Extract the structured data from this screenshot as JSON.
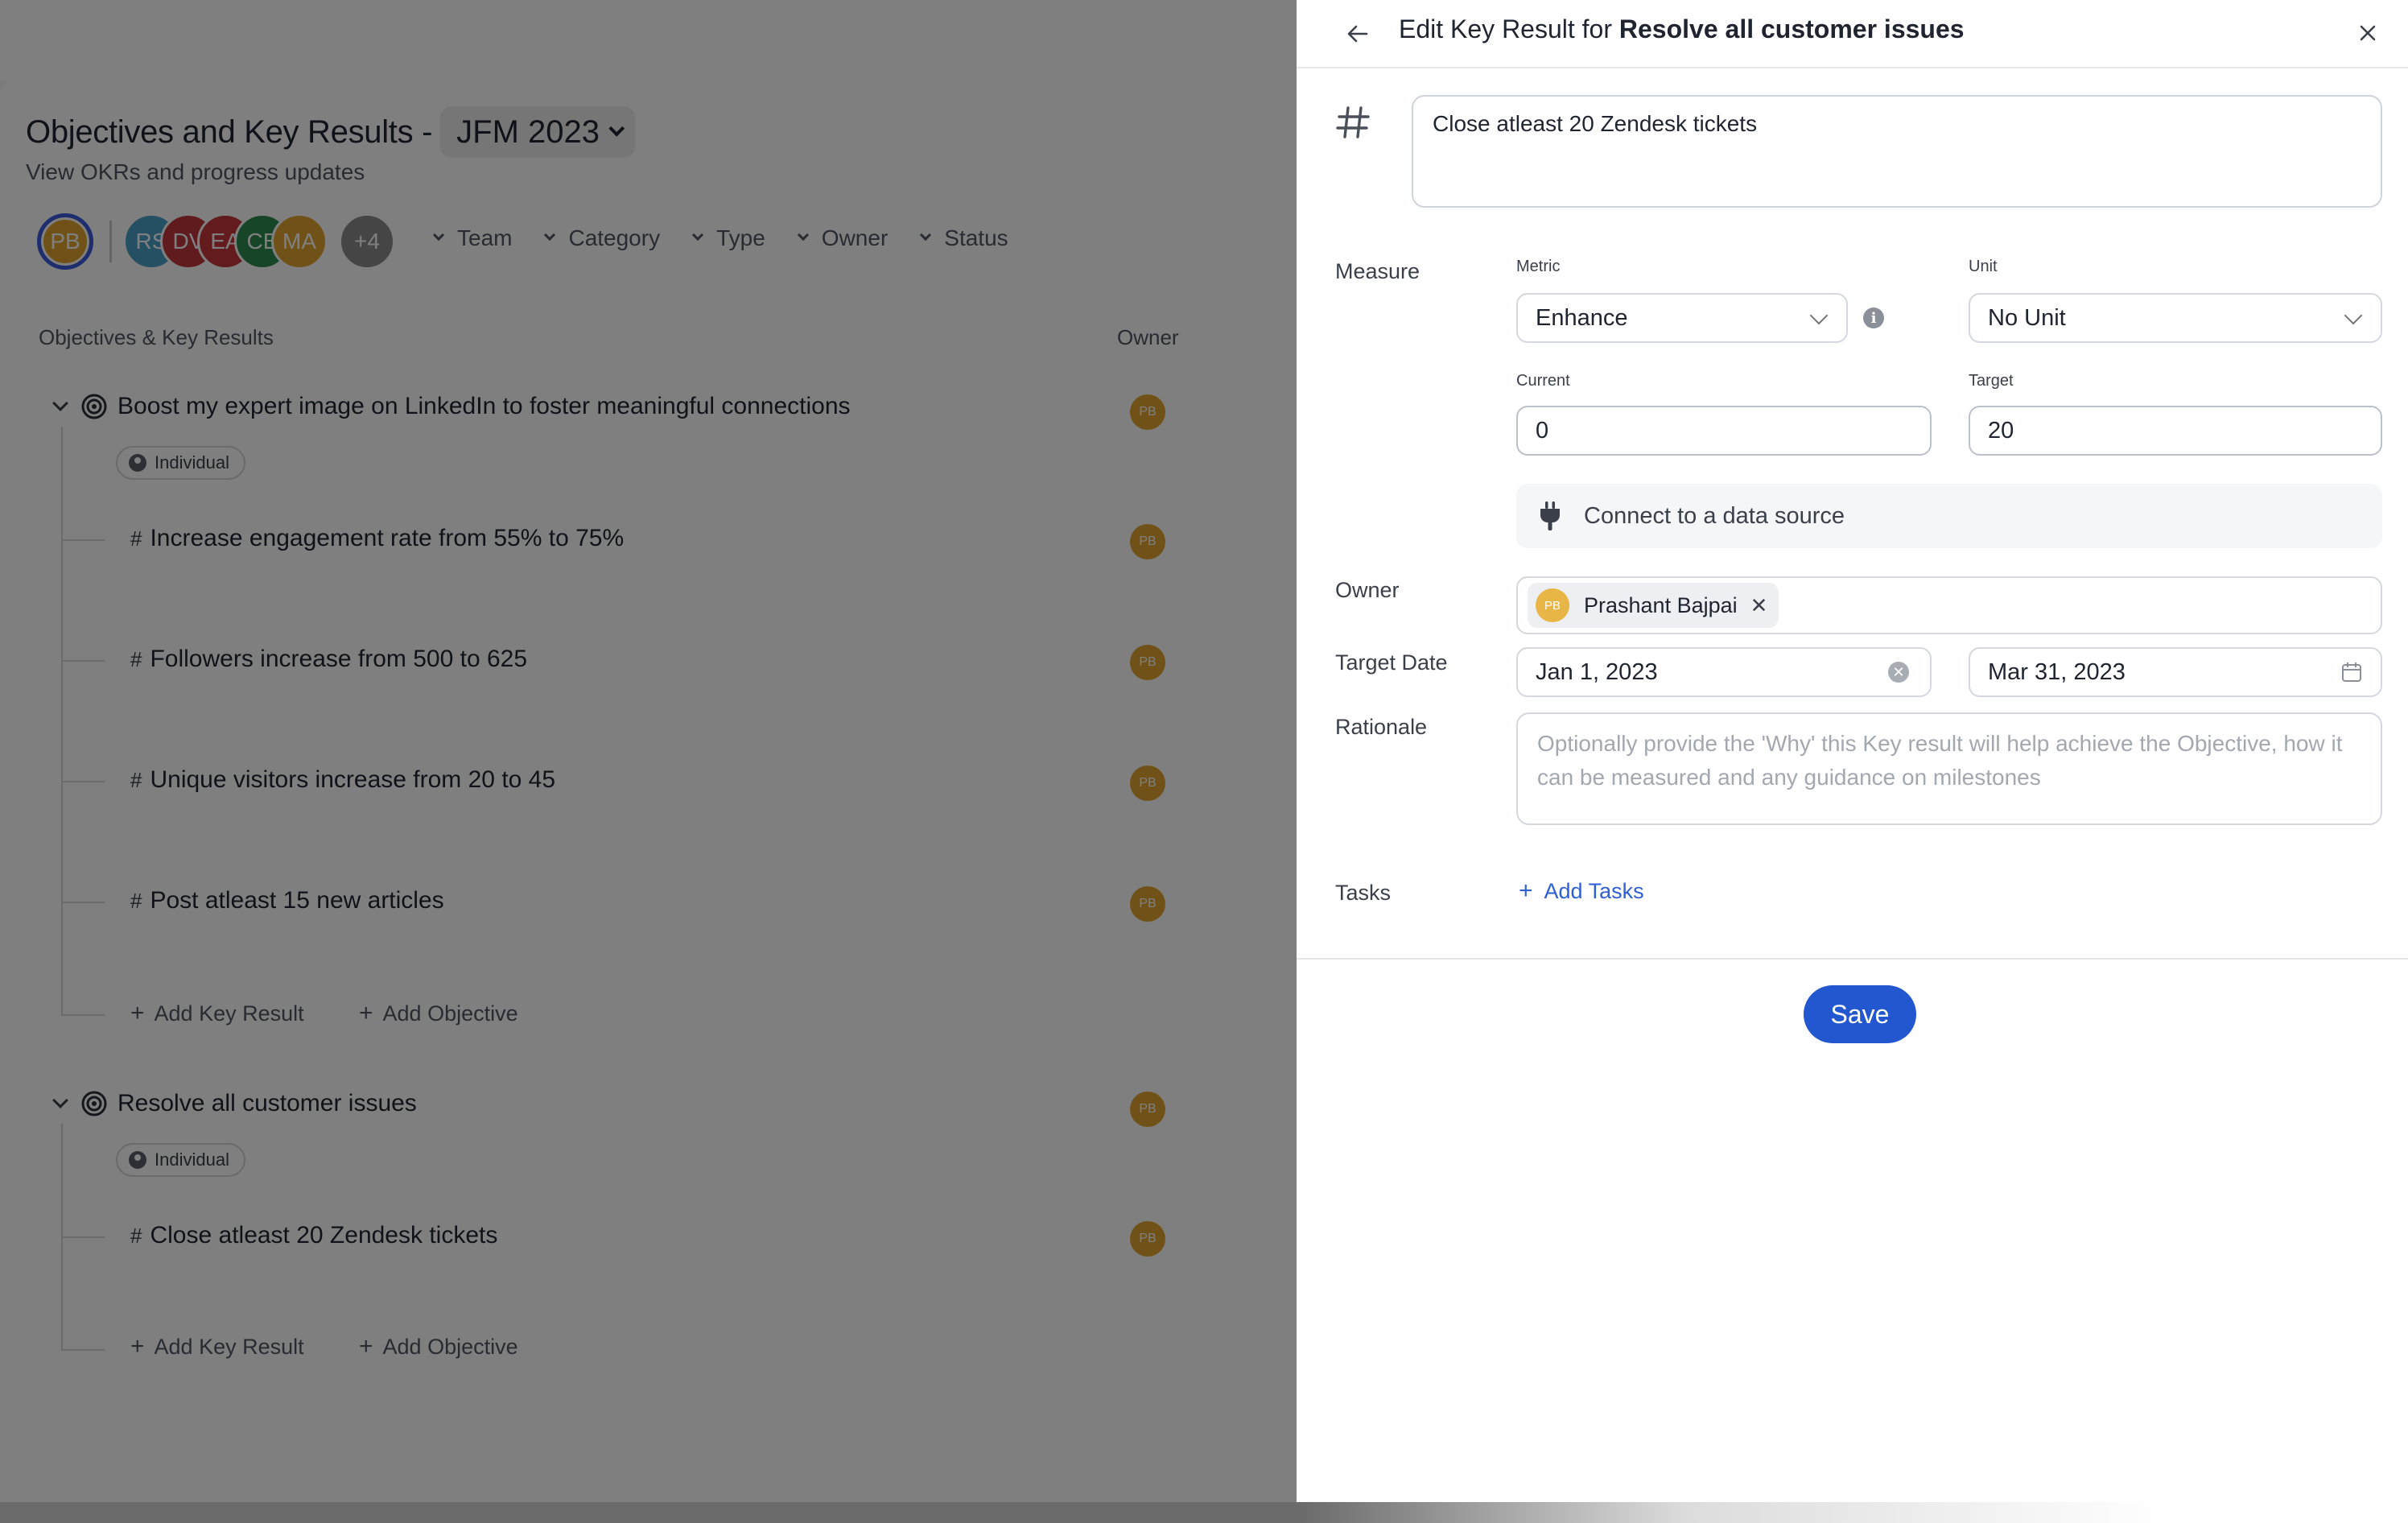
{
  "okr_page": {
    "title": "Objectives and Key Results -",
    "period": "JFM 2023",
    "subtitle": "View OKRs and progress updates",
    "current_user_initials": "PB",
    "avatars": [
      {
        "initials": "RS",
        "color": "#4aa0c8"
      },
      {
        "initials": "DV",
        "color": "#c0363f"
      },
      {
        "initials": "EA",
        "color": "#c8363c"
      },
      {
        "initials": "CB",
        "color": "#2f8a4e"
      },
      {
        "initials": "MA",
        "color": "#e0a531"
      }
    ],
    "more_count": "+4",
    "filters": [
      "Team",
      "Category",
      "Type",
      "Owner",
      "Status"
    ],
    "col_objectives": "Objectives & Key Results",
    "col_owner": "Owner",
    "add_key_result": "Add Key Result",
    "add_objective": "Add Objective",
    "objectives": [
      {
        "title": "Boost my expert image on LinkedIn to foster meaningful connections",
        "badge": "Individual",
        "owner": "PB",
        "key_results": [
          {
            "title": "Increase engagement rate from 55% to 75%",
            "owner": "PB"
          },
          {
            "title": "Followers increase from 500 to 625",
            "owner": "PB"
          },
          {
            "title": "Unique visitors increase from 20 to 45",
            "owner": "PB"
          },
          {
            "title": "Post atleast 15 new articles",
            "owner": "PB"
          }
        ]
      },
      {
        "title": "Resolve all customer issues",
        "badge": "Individual",
        "owner": "PB",
        "key_results": [
          {
            "title": "Close atleast 20 Zendesk tickets",
            "owner": "PB"
          }
        ]
      }
    ]
  },
  "drawer": {
    "title_prefix": "Edit Key Result for",
    "title_objective": "Resolve all customer issues",
    "kr_text": "Close atleast 20 Zendesk tickets",
    "measure_label": "Measure",
    "metric_label": "Metric",
    "metric_value": "Enhance",
    "unit_label": "Unit",
    "unit_value": "No Unit",
    "current_label": "Current",
    "current_value": "0",
    "target_label": "Target",
    "target_value": "20",
    "connect_label": "Connect to a data source",
    "owner_label": "Owner",
    "owner_name": "Prashant Bajpai",
    "owner_initials": "PB",
    "target_date_label": "Target Date",
    "start_date": "Jan 1, 2023",
    "end_date": "Mar 31, 2023",
    "rationale_label": "Rationale",
    "rationale_placeholder": "Optionally provide the 'Why' this Key result will help achieve the Objective, how it can be measured and any guidance on milestones",
    "tasks_label": "Tasks",
    "add_tasks_label": "Add Tasks",
    "save_label": "Save"
  },
  "colors": {
    "accent": "#2257cf",
    "owner_avatar": "#e0a531"
  }
}
